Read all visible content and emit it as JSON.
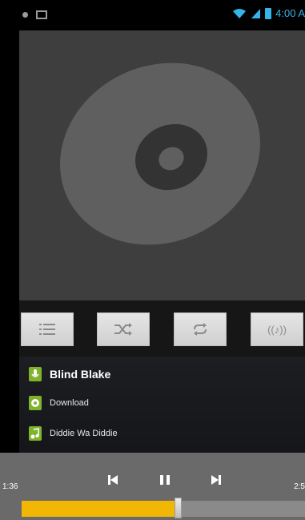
{
  "status_bar": {
    "time": "4:00 A",
    "accent_color": "#35b4e8",
    "icons": [
      "notification-dot-icon",
      "gallery-icon",
      "wifi-icon",
      "signal-icon",
      "battery-icon"
    ]
  },
  "album_art": {
    "icon": "cd-disc-icon"
  },
  "controls": {
    "buttons": [
      {
        "name": "playlist",
        "icon": "list-icon"
      },
      {
        "name": "shuffle",
        "icon": "shuffle-icon"
      },
      {
        "name": "repeat",
        "icon": "repeat-icon"
      },
      {
        "name": "audio-effects",
        "icon": "audio-effects-icon",
        "label": "((♪))"
      }
    ]
  },
  "track": {
    "artist": "Blind Blake",
    "album": "Download",
    "title": "Diddie Wa Diddie",
    "icon_color": "#7fb32c"
  },
  "transport": {
    "elapsed": "1:36",
    "total": "2:5",
    "progress_fraction": 0.55,
    "progress_color": "#f2b705"
  }
}
